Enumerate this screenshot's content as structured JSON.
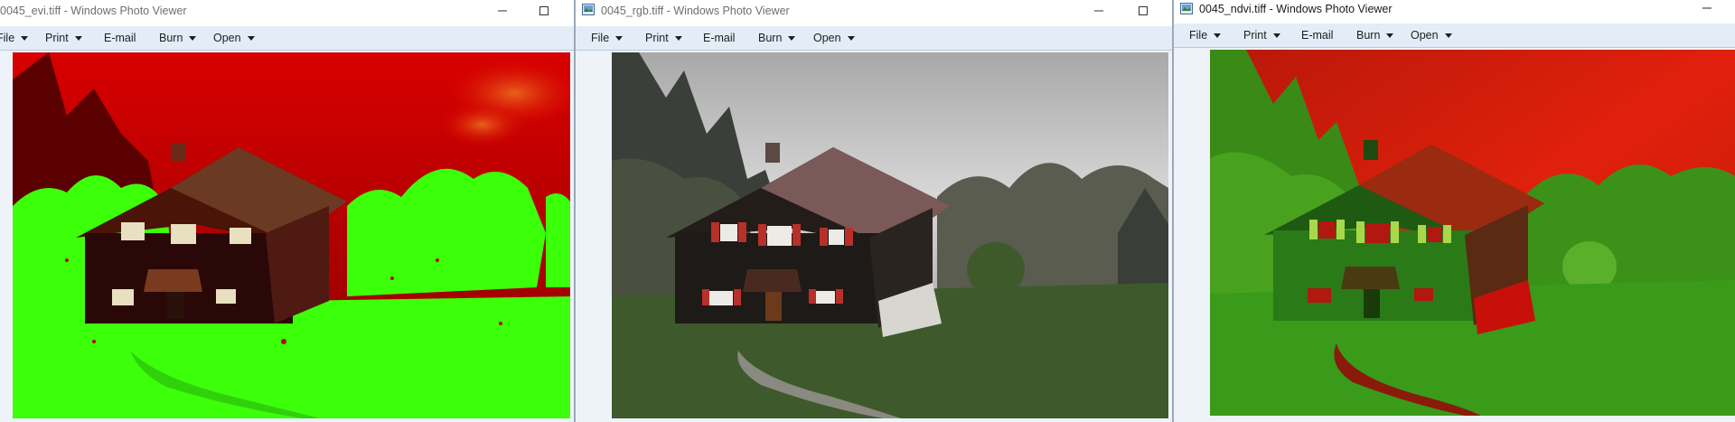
{
  "windows": [
    {
      "title": "0045_evi.tiff - Windows Photo Viewer",
      "menu": [
        "File",
        "Print",
        "E-mail",
        "Burn",
        "Open"
      ],
      "image_style": "evi"
    },
    {
      "title": "0045_rgb.tiff - Windows Photo Viewer",
      "menu": [
        "File",
        "Print",
        "E-mail",
        "Burn",
        "Open"
      ],
      "image_style": "rgb"
    },
    {
      "title": "0045_ndvi.tiff - Windows Photo Viewer",
      "menu": [
        "File",
        "Print",
        "E-mail",
        "Burn",
        "Open"
      ],
      "image_style": "ndvi"
    }
  ],
  "icons": {
    "app": "photo-viewer-icon",
    "minimize": "minimize-icon",
    "maximize": "maximize-icon",
    "menu_caret": "chevron-down-icon"
  },
  "colors": {
    "menubar_bg": "#e4edf7",
    "viewer_bg": "#eef3fa",
    "evi_vegetation": "#3cff0a",
    "evi_sky": "#c80000",
    "ndvi_green": "#2e9a16",
    "ndvi_red": "#d21a0a"
  }
}
